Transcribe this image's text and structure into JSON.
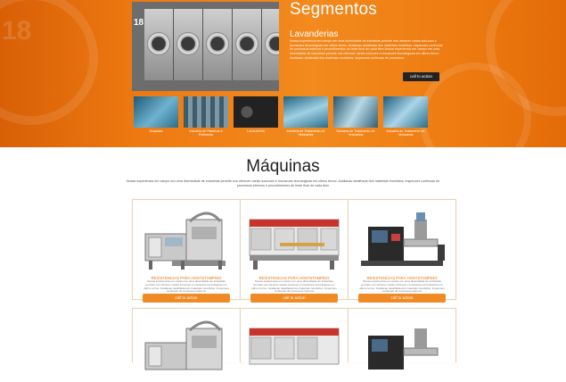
{
  "hero": {
    "title": "Segmentos",
    "subtitle": "Lavanderias",
    "description": "Nossa experiencia em campo em uma diversidade de industrias permite nos oferecer varias solucoes e inovacoes tecnologicas em ultimo termo. Avaliacao detalhada dos materiais recebidos, inspecoes continuas de processos internos e procedimentos de teste final de cada item Nossa experiencia em campo em uma diversidade de industrias permite nos oferecer varias solucoes e inovacoes tecnologicas em ultimo termo. Avaliacao detalhada dos materiais recebidos, inspecoes continuas de processos",
    "cta": "call to action",
    "photo_number": "18",
    "accent": "#f28a1e",
    "thumbnails": [
      {
        "label": "Hospitais"
      },
      {
        "label": "Industria de Plasticos e Polimeros"
      },
      {
        "label": "Lavanderias"
      },
      {
        "label": "Industria de Tratamento de Vestuarios"
      },
      {
        "label": "Industria de Tratamento de Vestuarios"
      },
      {
        "label": "Industria de Tratamento de Vestuarios"
      }
    ]
  },
  "machines": {
    "title": "Máquinas",
    "description": "Nossa experiencia em campo em uma diversidade de industrias permite nos oferecer varias solucoes e inovacoes tecnologicas em ultimo termo. Avaliacao detalhada dos materiais recebidos, inspecoes continuas de processos internos e procedimentos de teste final de cada item",
    "button_color": "#f08a24",
    "items": [
      {
        "title": "RESISTENCIAS PARA HOSTSTAMPING",
        "text": "Nossa experiencia em campo em uma diversidade de industrias permite nos oferecer varias solucoes e inovacoes tecnologicas em ultimo termo. Avaliacao detalhada dos materiais recebidos, inspecoes continuas de processos internos",
        "button": "call to action"
      },
      {
        "title": "RESISTENCIAS PARA HOSTSTAMPING",
        "text": "Nossa experiencia em campo em uma diversidade de industrias permite nos oferecer varias solucoes e inovacoes tecnologicas em ultimo termo. Avaliacao detalhada dos materiais recebidos, inspecoes continuas de processos internos",
        "button": "call to action"
      },
      {
        "title": "RESISTENCIAS PARA HOSTSTAMPING",
        "text": "Nossa experiencia em campo em uma diversidade de industrias permite nos oferecer varias solucoes e inovacoes tecnologicas em ultimo termo. Avaliacao detalhada dos materiais recebidos, inspecoes continuas de processos internos",
        "button": "call to action"
      }
    ]
  }
}
